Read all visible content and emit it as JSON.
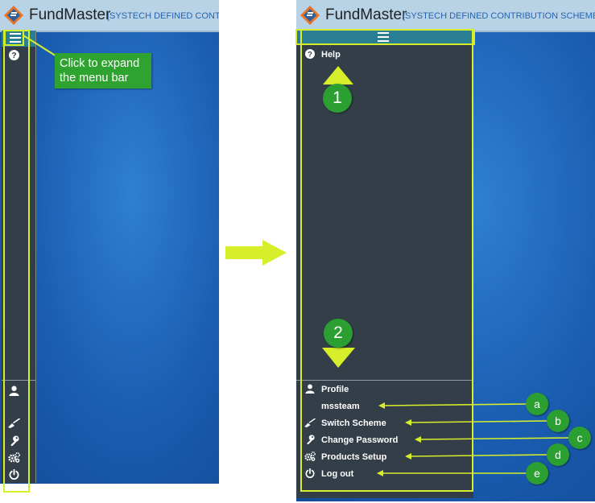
{
  "app": {
    "brand": "FundMaster",
    "scheme_left": "[SYSTECH DEFINED CONTRIBUTI",
    "scheme_right": "[SYSTECH DEFINED CONTRIBUTION SCHEME]@Co"
  },
  "callout": {
    "line1": "Click to expand",
    "line2": "the menu bar"
  },
  "menu": {
    "help": "Help",
    "profile": "Profile",
    "username": "mssteam",
    "switch_scheme": "Switch Scheme",
    "change_password": "Change Password",
    "products_setup": "Products Setup",
    "log_out": "Log out"
  },
  "badges": {
    "one": "1",
    "two": "2",
    "a": "a",
    "b": "b",
    "c": "c",
    "d": "d",
    "e": "e"
  },
  "icons": {
    "menu": "hamburger-icon",
    "help": "question-circle-icon",
    "profile": "user-icon",
    "switch": "broom-icon",
    "password": "key-icon",
    "setup": "cogs-icon",
    "logout": "power-icon"
  },
  "colors": {
    "sidebar": "#333e48",
    "topbar": "#b9d3e6",
    "accent": "#2b7f95",
    "highlight": "#d6ef2a",
    "badge": "#2c9f32",
    "desktop": "#1e63b5"
  }
}
